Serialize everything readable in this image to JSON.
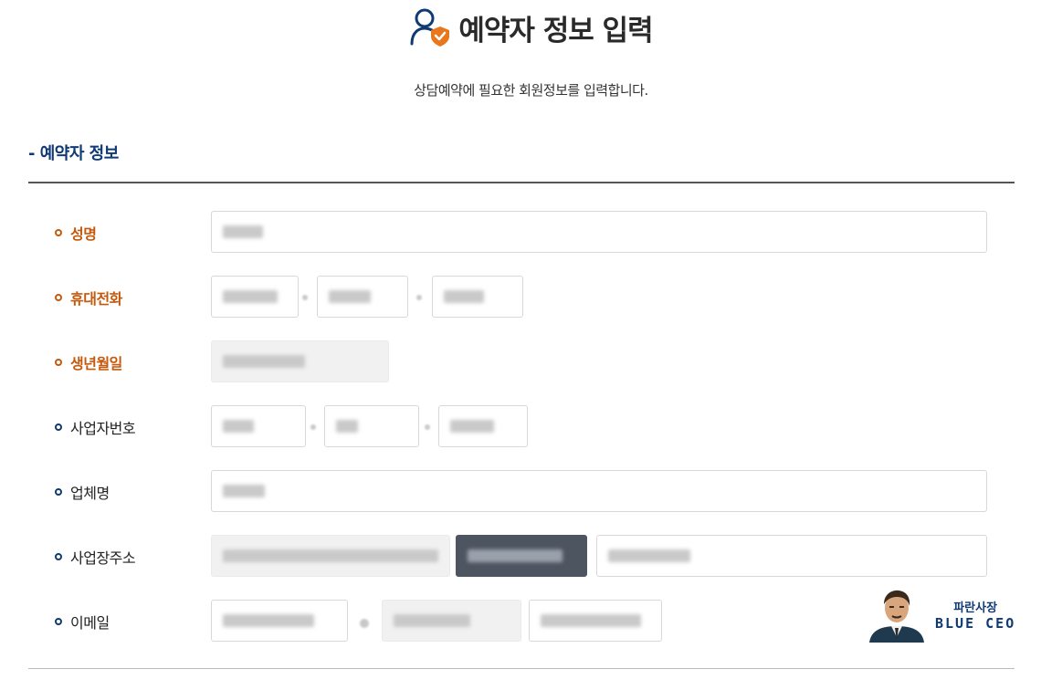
{
  "header": {
    "title": "예약자 정보 입력",
    "title_icon": "user-shield-icon",
    "subtitle": "상담예약에 필요한 회원정보를 입력합니다."
  },
  "section": {
    "title": "- 예약자 정보"
  },
  "fields": [
    {
      "label": "성명",
      "required": true
    },
    {
      "label": "휴대전화",
      "required": true
    },
    {
      "label": "생년월일",
      "required": true
    },
    {
      "label": "사업자번호",
      "required": false
    },
    {
      "label": "업체명",
      "required": false
    },
    {
      "label": "사업장주소",
      "required": false
    },
    {
      "label": "이메일",
      "required": false
    }
  ],
  "badge": {
    "name_ko": "파란사장",
    "name_en": "BLUE CEO"
  },
  "colors": {
    "required_label": "#c55a0d",
    "section_title": "#103a74",
    "bullet_optional": "#103a74",
    "icon_orange": "#e8771e"
  }
}
